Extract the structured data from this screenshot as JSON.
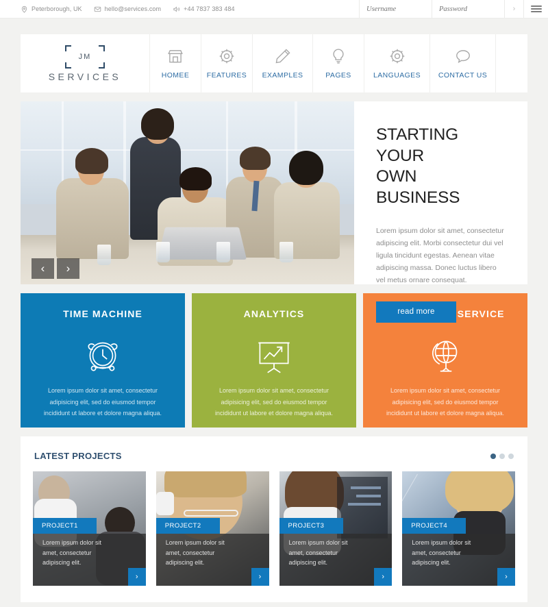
{
  "topbar": {
    "location": "Peterborough, UK",
    "email": "hello@services.com",
    "phone": "+44 7837 383 484",
    "username_placeholder": "Username",
    "password_placeholder": "Password",
    "username_value": "",
    "password_value": "",
    "submit_icon": "chevron-right-icon",
    "menu_icon": "hamburger-icon"
  },
  "header": {
    "logo_mark": "JM",
    "logo_text": "SERVICES",
    "nav": [
      {
        "label": "HOMEE",
        "icon": "store-icon"
      },
      {
        "label": "FEATURES",
        "icon": "gear-icon"
      },
      {
        "label": "EXAMPLES",
        "icon": "pencil-icon"
      },
      {
        "label": "PAGES",
        "icon": "lightbulb-icon"
      },
      {
        "label": "LANGUAGES",
        "icon": "gear-icon"
      },
      {
        "label": "CONTACT US",
        "icon": "speech-bubble-icon"
      }
    ]
  },
  "hero": {
    "title_line1": "STARTING YOUR",
    "title_line2": "OWN BUSINESS",
    "body": "Lorem ipsum dolor sit amet, consectetur adipiscing elit. Morbi consectetur dui vel ligula tincidunt egestas. Aenean vitae adipiscing massa. Donec luctus libero vel metus ornare consequat.",
    "cta_label": "read more",
    "cta_color": "#1279bd",
    "prev_icon": "chevron-left-icon",
    "next_icon": "chevron-right-icon"
  },
  "features": [
    {
      "title": "TIME MACHINE",
      "icon": "alarm-clock-icon",
      "color": "#0d7bb5",
      "text": "Lorem ipsum dolor sit amet, consectetur adipisicing elit, sed do eiusmod tempor incididunt ut labore et dolore magna aliqua."
    },
    {
      "title": "ANALYTICS",
      "icon": "presentation-chart-icon",
      "color": "#9bb23f",
      "text": "Lorem ipsum dolor sit amet, consectetur adipisicing elit, sed do eiusmod tempor incididunt ut labore et dolore magna aliqua."
    },
    {
      "title": "WORLDWIDE SERVICE",
      "icon": "globe-icon",
      "color": "#f4823c",
      "text": "Lorem ipsum dolor sit amet, consectetur adipisicing elit, sed do eiusmod tempor incididunt ut labore et dolore magna aliqua."
    }
  ],
  "projects": {
    "heading": "LATEST PROJECTS",
    "pagination": {
      "total": 3,
      "active": 1
    },
    "items": [
      {
        "tag": "PROJECT1",
        "text": "Lorem ipsum dolor sit amet, consectetur adipiscing elit.",
        "arrow_icon": "chevron-right-icon"
      },
      {
        "tag": "PROJECT2",
        "text": "Lorem ipsum dolor sit amet, consectetur adipiscing elit.",
        "arrow_icon": "chevron-right-icon"
      },
      {
        "tag": "PROJECT3",
        "text": "Lorem ipsum dolor sit amet, consectetur adipiscing elit.",
        "arrow_icon": "chevron-right-icon"
      },
      {
        "tag": "PROJECT4",
        "text": "Lorem ipsum dolor sit amet, consectetur adipiscing elit.",
        "arrow_icon": "chevron-right-icon"
      }
    ]
  }
}
